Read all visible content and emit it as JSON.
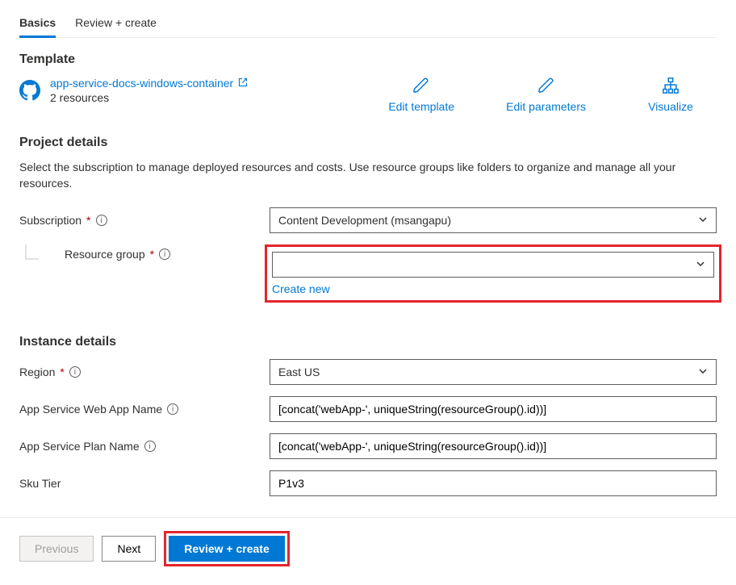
{
  "tabs": {
    "basics": "Basics",
    "review": "Review + create"
  },
  "template": {
    "heading": "Template",
    "link": "app-service-docs-windows-container",
    "resources": "2 resources",
    "actions": {
      "edit_template": "Edit template",
      "edit_parameters": "Edit parameters",
      "visualize": "Visualize"
    }
  },
  "project": {
    "heading": "Project details",
    "desc": "Select the subscription to manage deployed resources and costs. Use resource groups like folders to organize and manage all your resources.",
    "subscription_label": "Subscription",
    "subscription_value": "Content Development (msangapu)",
    "resource_group_label": "Resource group",
    "resource_group_value": "",
    "create_new": "Create new"
  },
  "instance": {
    "heading": "Instance details",
    "region_label": "Region",
    "region_value": "East US",
    "webapp_label": "App Service Web App Name",
    "webapp_value": "[concat('webApp-', uniqueString(resourceGroup().id))]",
    "plan_label": "App Service Plan Name",
    "plan_value": "[concat('webApp-', uniqueString(resourceGroup().id))]",
    "sku_label": "Sku Tier",
    "sku_value": "P1v3"
  },
  "footer": {
    "previous": "Previous",
    "next": "Next",
    "review": "Review + create"
  }
}
